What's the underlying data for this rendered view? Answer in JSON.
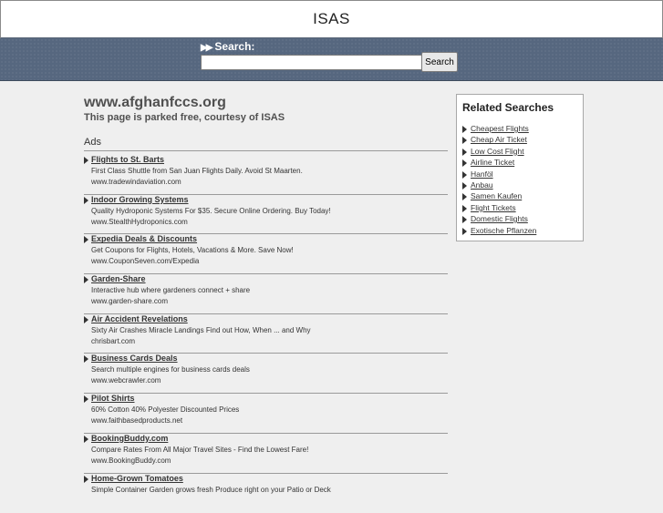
{
  "header": {
    "title": "ISAS"
  },
  "search": {
    "label": "Search:",
    "arrows": "▶▶",
    "value": "",
    "button": "Search"
  },
  "page": {
    "domain": "www.afghanfccs.org",
    "courtesy": "This page is parked free, courtesy of ISAS",
    "ads_title": "Ads"
  },
  "ads": [
    {
      "title": "Flights to St. Barts",
      "desc": "First Class Shuttle from San Juan Flights Daily. Avoid St Maarten.",
      "url": "www.tradewindaviation.com"
    },
    {
      "title": "Indoor Growing Systems",
      "desc": "Quality Hydroponic Systems For $35. Secure Online Ordering. Buy Today!",
      "url": "www.StealthHydroponics.com"
    },
    {
      "title": "Expedia Deals & Discounts",
      "desc": "Get Coupons for Flights, Hotels, Vacations & More. Save Now!",
      "url": "www.CouponSeven.com/Expedia"
    },
    {
      "title": "Garden-Share",
      "desc": "Interactive hub where gardeners connect + share",
      "url": "www.garden-share.com"
    },
    {
      "title": "Air Accident Revelations",
      "desc": "Sixty Air Crashes Miracle Landings Find out How, When ... and Why",
      "url": "chrisbart.com"
    },
    {
      "title": "Business Cards Deals",
      "desc": "Search multiple engines for business cards deals",
      "url": "www.webcrawler.com"
    },
    {
      "title": "Pilot Shirts",
      "desc": "60% Cotton 40% Polyester Discounted Prices",
      "url": "www.faithbasedproducts.net"
    },
    {
      "title": "BookingBuddy.com",
      "desc": "Compare Rates From All Major Travel Sites - Find the Lowest Fare!",
      "url": "www.BookingBuddy.com"
    },
    {
      "title": "Home-Grown Tomatoes",
      "desc": "Simple Container Garden grows fresh Produce right on your Patio or Deck",
      "url": ""
    }
  ],
  "related": {
    "title": "Related Searches",
    "items": [
      " Cheapest Flights",
      " Cheap Air Ticket",
      " Low Cost Flight",
      " Airline Ticket",
      " Hanföl",
      " Anbau",
      " Samen Kaufen",
      " Flight Tickets",
      " Domestic Flights",
      " Exotische Pflanzen"
    ]
  }
}
